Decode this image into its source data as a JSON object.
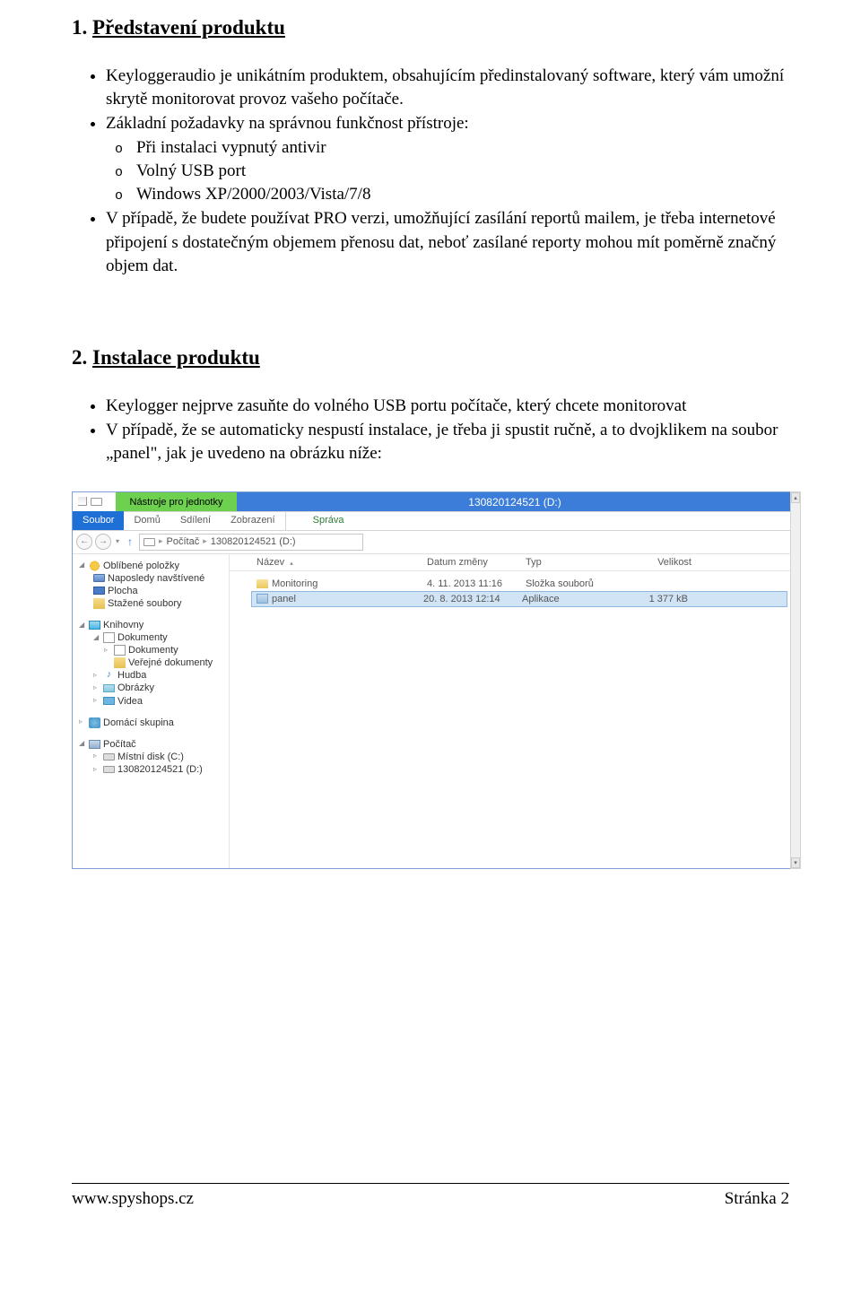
{
  "section1": {
    "num": "1.",
    "title": "Představení produktu",
    "b1": "Keyloggeraudio je unikátním produktem, obsahujícím předinstalovaný software, který vám umožní skrytě monitorovat provoz vašeho počítače.",
    "b2": "Základní požadavky na správnou funkčnost přístroje:",
    "b2a": "Při instalaci vypnutý antivir",
    "b2b": "Volný USB port",
    "b2c": "Windows XP/2000/2003/Vista/7/8",
    "b3": "V případě, že budete používat PRO verzi, umožňující zasílání reportů mailem, je třeba internetové připojení s dostatečným objemem přenosu dat, neboť zasílané reporty mohou mít poměrně značný objem dat."
  },
  "section2": {
    "num": "2.",
    "title": "Instalace produktu",
    "b1": "Keylogger nejprve zasuňte do volného USB portu počítače, který chcete monitorovat",
    "b2": "V případě, že se automaticky nespustí instalace, je třeba ji spustit ručně, a to dvojklikem na soubor „panel\", jak je uvedeno na obrázku níže:"
  },
  "explorer": {
    "titleTools": "Nástroje pro jednotky",
    "titleDrive": "130820124521 (D:)",
    "tabs": {
      "soubor": "Soubor",
      "domu": "Domů",
      "sdileni": "Sdílení",
      "zobrazeni": "Zobrazení",
      "sprava": "Správa"
    },
    "address": {
      "back": "←",
      "fwd": "→",
      "up": "↑",
      "crumb1": "Počítač",
      "crumb2": "130820124521 (D:)"
    },
    "nav": {
      "fav": "Oblíbené položky",
      "recent": "Naposledy navštívené",
      "desktop": "Plocha",
      "downloads": "Stažené soubory",
      "libraries": "Knihovny",
      "docs": "Dokumenty",
      "docsSub": "Dokumenty",
      "pubDocs": "Veřejné dokumenty",
      "music": "Hudba",
      "pics": "Obrázky",
      "video": "Videa",
      "homegroup": "Domácí skupina",
      "computer": "Počítač",
      "localC": "Místní disk (C:)",
      "driveD": "130820124521 (D:)"
    },
    "cols": {
      "name": "Název",
      "date": "Datum změny",
      "type": "Typ",
      "size": "Velikost"
    },
    "rows": [
      {
        "name": "Monitoring",
        "date": "4. 11. 2013 11:16",
        "type": "Složka souborů",
        "size": ""
      },
      {
        "name": "panel",
        "date": "20. 8. 2013 12:14",
        "type": "Aplikace",
        "size": "1 377 kB"
      }
    ]
  },
  "footer": {
    "left": "www.spyshops.cz",
    "right": "Stránka 2"
  }
}
